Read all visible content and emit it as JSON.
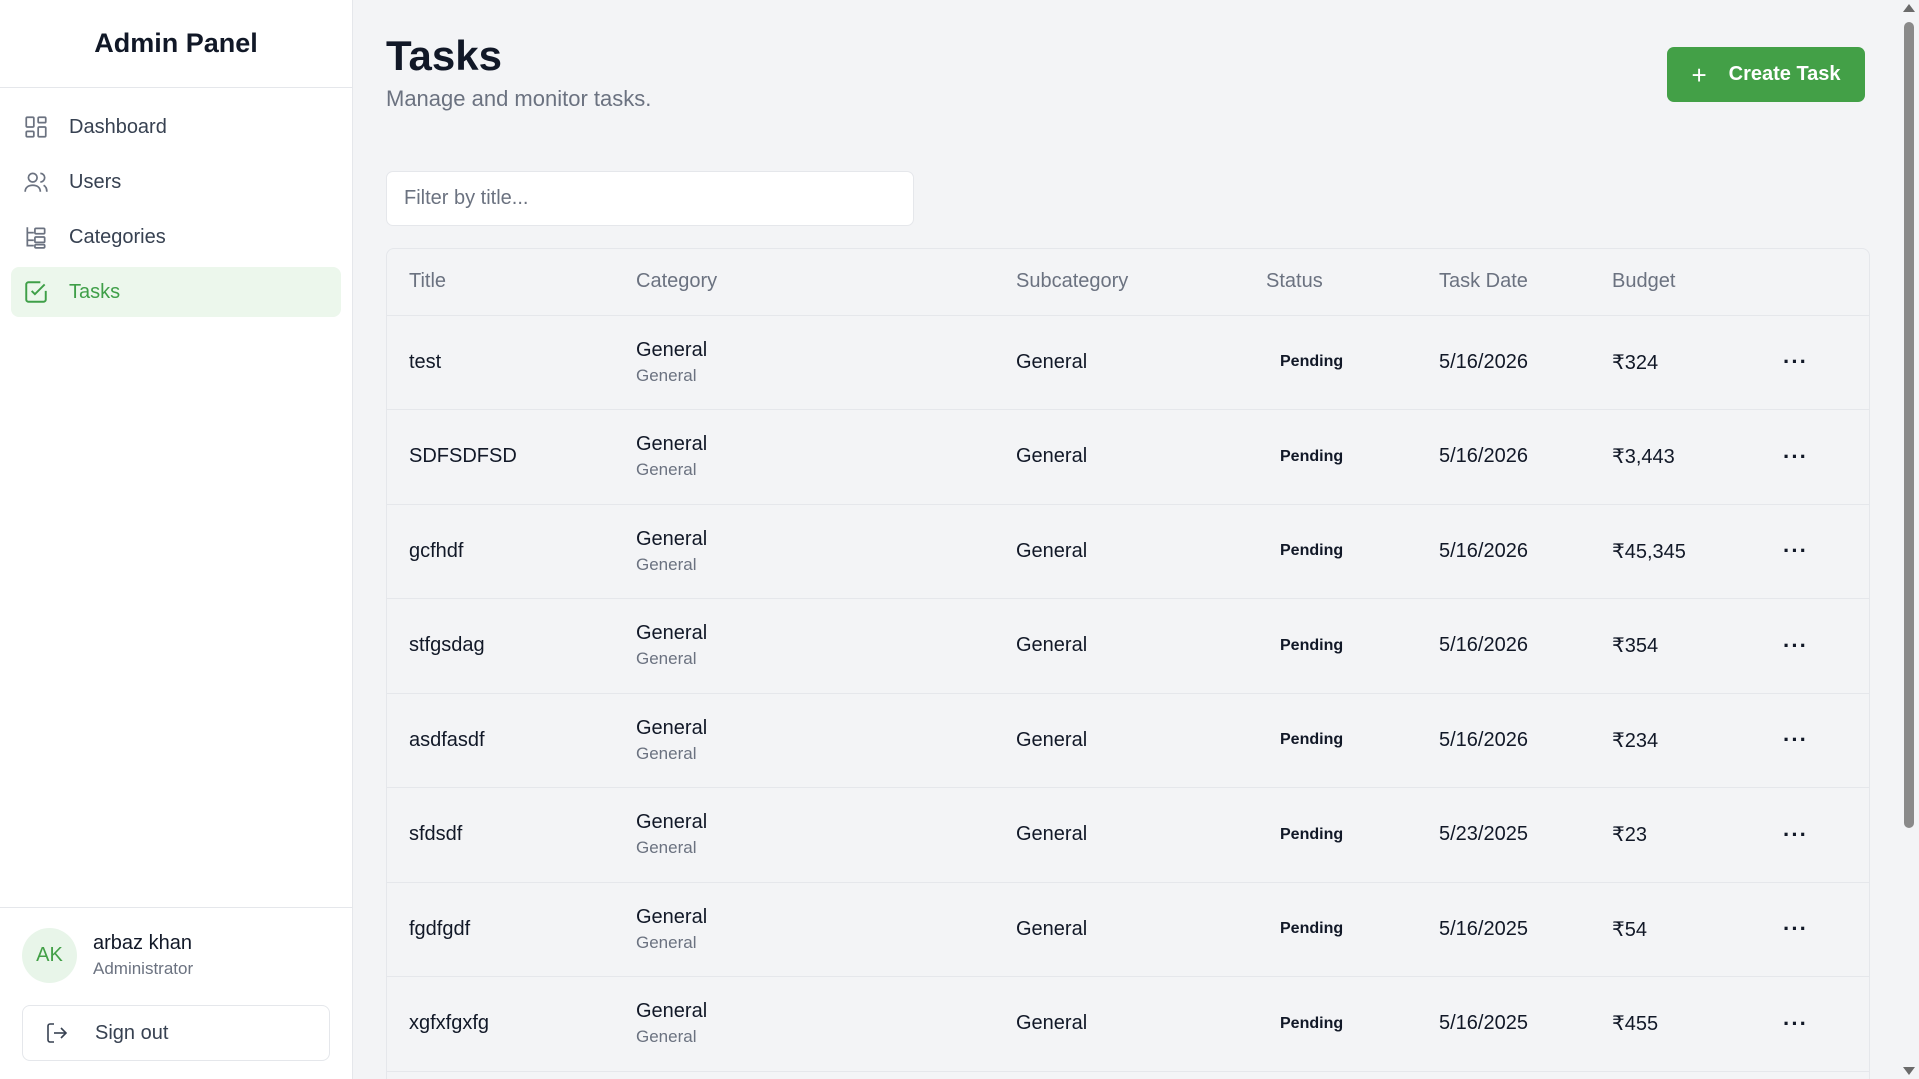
{
  "app": {
    "brand": "Admin Panel"
  },
  "sidebar": {
    "items": [
      {
        "label": "Dashboard",
        "icon": "dashboard-icon"
      },
      {
        "label": "Users",
        "icon": "users-icon"
      },
      {
        "label": "Categories",
        "icon": "categories-icon"
      },
      {
        "label": "Tasks",
        "icon": "tasks-icon",
        "active": true
      }
    ],
    "user": {
      "initials": "AK",
      "name": "arbaz khan",
      "role": "Administrator"
    },
    "signout_label": "Sign out"
  },
  "page": {
    "title": "Tasks",
    "subtitle": "Manage and monitor tasks.",
    "create_label": "Create Task",
    "filter_placeholder": "Filter by title..."
  },
  "table": {
    "headers": [
      "Title",
      "Category",
      "Subcategory",
      "Status",
      "Task Date",
      "Budget"
    ],
    "rows": [
      {
        "title": "test",
        "category": "General",
        "category_sub": "General",
        "subcategory": "General",
        "status": "Pending",
        "date": "5/16/2026",
        "budget": "₹324"
      },
      {
        "title": "SDFSDFSD",
        "category": "General",
        "category_sub": "General",
        "subcategory": "General",
        "status": "Pending",
        "date": "5/16/2026",
        "budget": "₹3,443"
      },
      {
        "title": "gcfhdf",
        "category": "General",
        "category_sub": "General",
        "subcategory": "General",
        "status": "Pending",
        "date": "5/16/2026",
        "budget": "₹45,345"
      },
      {
        "title": "stfgsdag",
        "category": "General",
        "category_sub": "General",
        "subcategory": "General",
        "status": "Pending",
        "date": "5/16/2026",
        "budget": "₹354"
      },
      {
        "title": "asdfasdf",
        "category": "General",
        "category_sub": "General",
        "subcategory": "General",
        "status": "Pending",
        "date": "5/16/2026",
        "budget": "₹234"
      },
      {
        "title": "sfdsdf",
        "category": "General",
        "category_sub": "General",
        "subcategory": "General",
        "status": "Pending",
        "date": "5/23/2025",
        "budget": "₹23"
      },
      {
        "title": "fgdfgdf",
        "category": "General",
        "category_sub": "General",
        "subcategory": "General",
        "status": "Pending",
        "date": "5/16/2025",
        "budget": "₹54"
      },
      {
        "title": "xgfxfgxfg",
        "category": "General",
        "category_sub": "General",
        "subcategory": "General",
        "status": "Pending",
        "date": "5/16/2025",
        "budget": "₹455"
      }
    ],
    "row_action_icon": "more-horizontal-icon"
  },
  "colors": {
    "accent": "#43a047",
    "active_bg": "#ecf7ec",
    "muted": "#6b7280"
  }
}
